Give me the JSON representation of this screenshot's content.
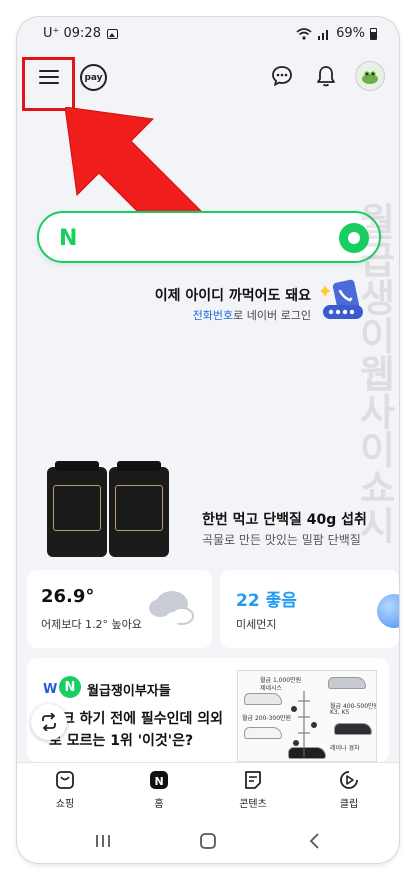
{
  "status_bar": {
    "carrier_time": "U⁺ 09:28",
    "battery": "69%"
  },
  "header": {
    "pay_label": "pay"
  },
  "search": {
    "logo": "N"
  },
  "watermark": "월급생이웹사이쇼시",
  "login_promo": {
    "title": "이제 아이디 까먹어도 돼요",
    "sub_link": "전화번호",
    "sub_rest": "로 네이버 로그인"
  },
  "ad": {
    "title": "한번 먹고 단백질 40g 섭취",
    "subtitle": "곡물로 만든 맛있는 밀팜 단백질"
  },
  "weather": {
    "temperature": "26.9°",
    "compare": "어제보다 1.2° 높아요"
  },
  "dust": {
    "value": "22 좋음",
    "label": "미세먼지"
  },
  "news": {
    "publisher": "월급쟁이부자들",
    "headline": "리크 하기 전에 필수인데 의외로 모르는 1위 '이것'은?",
    "thumb_texts": [
      "월급 1,000만원",
      "제네시스",
      "월급 200-300만원",
      "월급 400-500만원",
      "K3, K5",
      "레이나 경차"
    ]
  },
  "tabs": [
    {
      "label": "쇼핑",
      "icon": "shopping-bag-icon"
    },
    {
      "label": "홈",
      "icon": "naver-home-icon"
    },
    {
      "label": "콘텐츠",
      "icon": "contents-icon"
    },
    {
      "label": "클립",
      "icon": "clip-play-icon"
    }
  ],
  "colors": {
    "naver_green": "#19ce60",
    "highlight_red": "#e0141b",
    "link_blue": "#1e6cd9",
    "dust_blue": "#1e9df0"
  }
}
